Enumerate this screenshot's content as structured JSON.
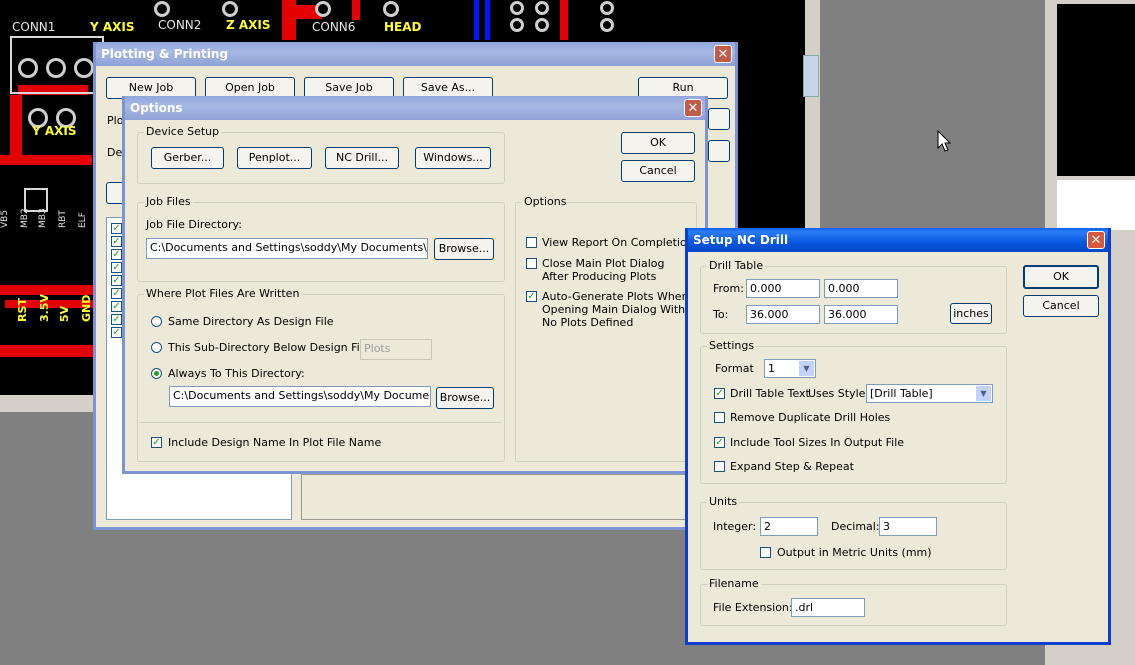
{
  "pcb": {
    "labels": [
      "CONN1",
      "Y AXIS",
      "CONN2",
      "Z AXIS",
      "CONN6",
      "HEAD",
      "Y AXIS"
    ],
    "vertical_labels": [
      "RST",
      "3.5V",
      "5V",
      "GND"
    ],
    "small_vertical_labels": [
      "VB5",
      "MB2",
      "MB3",
      "RBT",
      "ELF"
    ]
  },
  "plotting": {
    "title": "Plotting & Printing",
    "buttons": [
      "New Job",
      "Open Job",
      "Save Job",
      "Save As...",
      "Run"
    ],
    "left_labels": [
      "Plot",
      "Des"
    ]
  },
  "options": {
    "title": "Options",
    "device_setup": {
      "label": "Device Setup",
      "buttons": [
        "Gerber...",
        "Penplot...",
        "NC Drill...",
        "Windows..."
      ]
    },
    "ok": "OK",
    "cancel": "Cancel",
    "job_files": {
      "label": "Job Files",
      "dir_label": "Job File Directory:",
      "dir_value": "C:\\Documents and Settings\\soddy\\My Documents\\TEMP",
      "browse": "Browse..."
    },
    "plot_files": {
      "label": "Where Plot Files Are Written",
      "opt1": "Same Directory As Design File",
      "opt2": "This Sub-Directory Below Design File:",
      "opt2_value": "Plots",
      "opt3": "Always To This Directory:",
      "opt3_value": "C:\\Documents and Settings\\soddy\\My Documents\\TE",
      "browse": "Browse...",
      "include_name": "Include Design Name In Plot File Name"
    },
    "opts": {
      "label": "Options",
      "view_report": "View Report On Completion",
      "close_main_1": "Close Main Plot Dialog",
      "close_main_2": "After Producing Plots",
      "auto_gen_1": "Auto-Generate Plots When",
      "auto_gen_2": "Opening Main Dialog With",
      "auto_gen_3": "No Plots Defined"
    }
  },
  "nc_drill": {
    "title": "Setup NC Drill",
    "ok": "OK",
    "cancel": "Cancel",
    "drill_table": {
      "label": "Drill Table",
      "from_label": "From:",
      "from_x": "0.000",
      "from_y": "0.000",
      "to_label": "To:",
      "to_x": "36.000",
      "to_y": "36.000",
      "units_btn": "inches"
    },
    "settings": {
      "label": "Settings",
      "format_label": "Format",
      "format_value": "1",
      "drill_table_text": "Drill Table Text",
      "uses_style": "Uses Style:",
      "style_value": "[Drill Table]",
      "remove_dup": "Remove Duplicate Drill Holes",
      "include_tool": "Include Tool Sizes In Output File",
      "expand_step": "Expand Step & Repeat"
    },
    "units": {
      "label": "Units",
      "integer_label": "Integer:",
      "integer_value": "2",
      "decimal_label": "Decimal:",
      "decimal_value": "3",
      "metric": "Output in Metric Units (mm)"
    },
    "filename": {
      "label": "Filename",
      "ext_label": "File Extension:",
      "ext_value": ".drl"
    }
  }
}
